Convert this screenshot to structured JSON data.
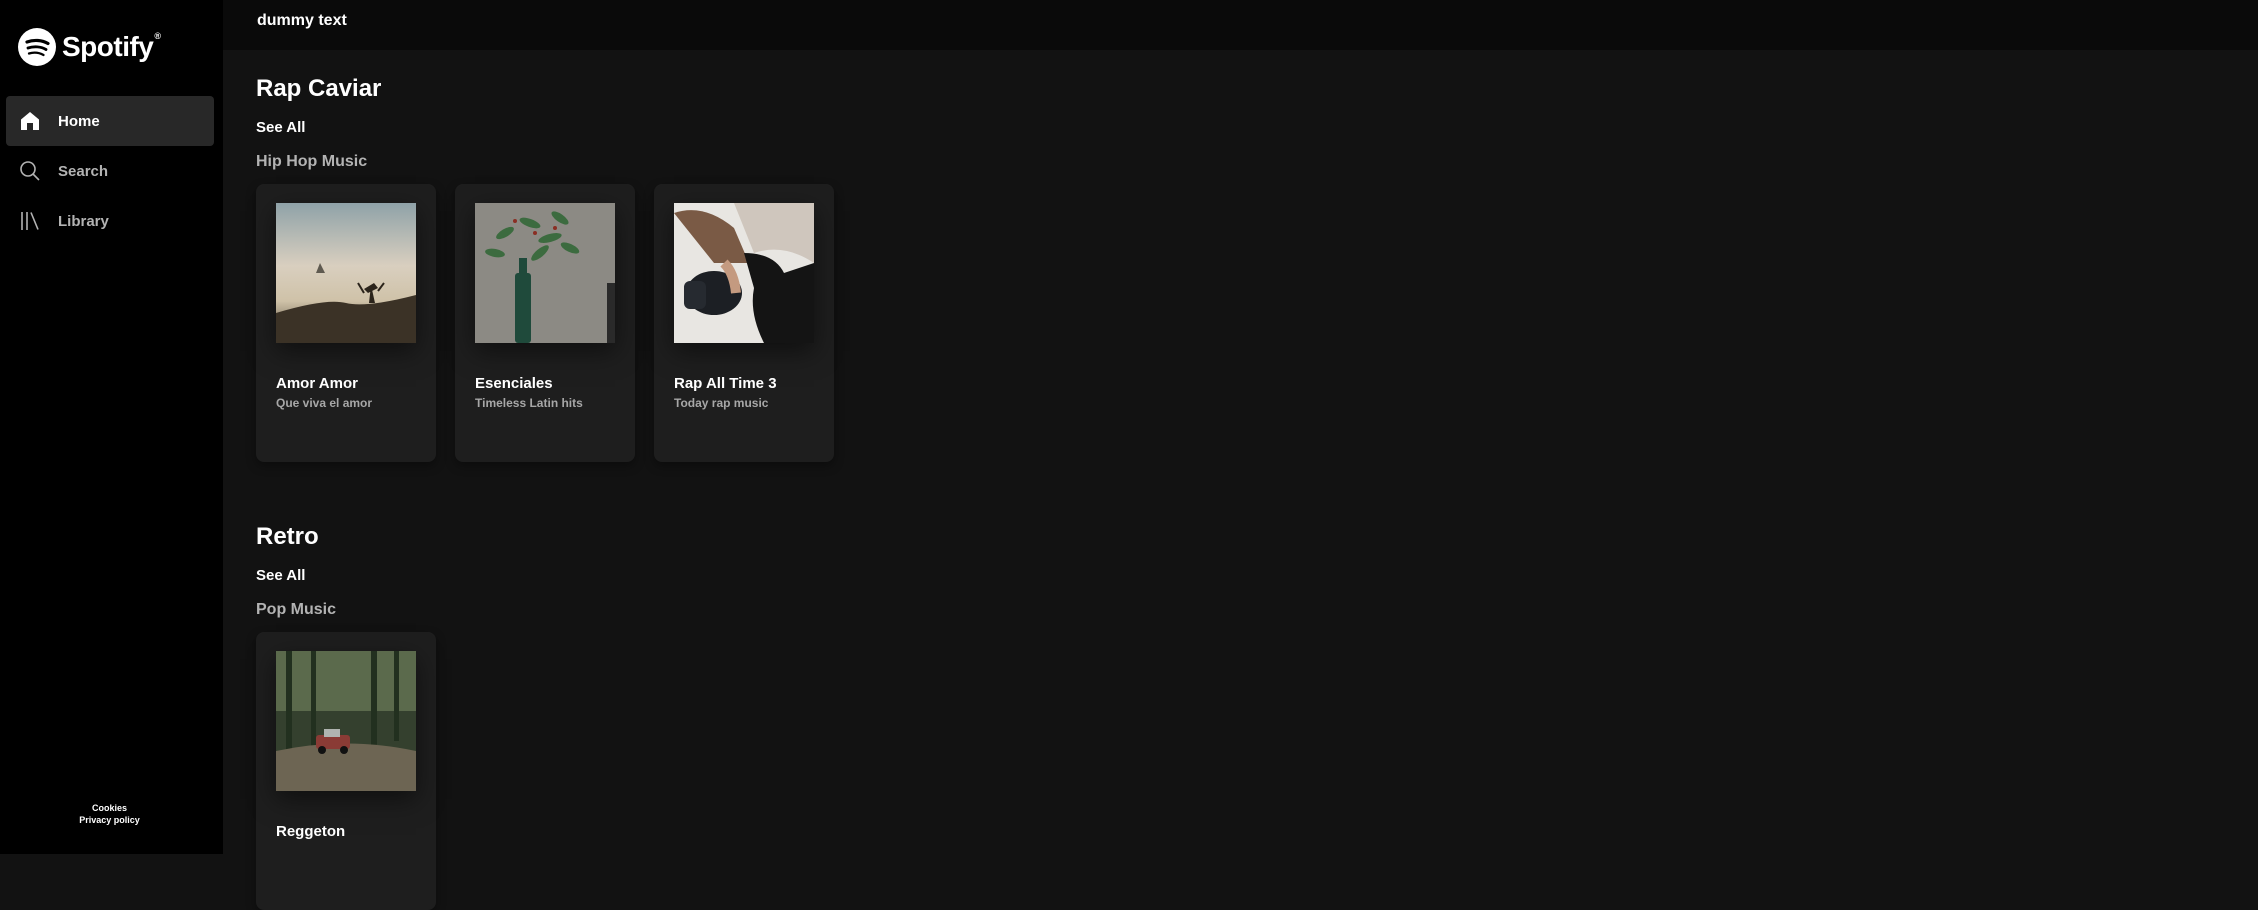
{
  "brand": {
    "name": "Spotify",
    "reg": "®"
  },
  "sidebar": {
    "items": [
      {
        "label": "Home",
        "icon": "home-icon",
        "active": true
      },
      {
        "label": "Search",
        "icon": "search-icon",
        "active": false
      },
      {
        "label": "Library",
        "icon": "library-icon",
        "active": false
      }
    ],
    "legal": {
      "cookies": "Cookies",
      "privacy": "Privacy policy"
    }
  },
  "topbar": {
    "text": "dummy text"
  },
  "sections": [
    {
      "title": "Rap Caviar",
      "see_all": "See All",
      "subtitle": "Hip Hop Music",
      "cards": [
        {
          "title": "Amor Amor",
          "subtitle": "Que viva el amor"
        },
        {
          "title": "Esenciales",
          "subtitle": "Timeless Latin hits"
        },
        {
          "title": "Rap All Time 3",
          "subtitle": "Today rap music"
        }
      ]
    },
    {
      "title": "Retro",
      "see_all": "See All",
      "subtitle": "Pop Music",
      "cards": [
        {
          "title": "Reggeton",
          "subtitle": ""
        }
      ]
    }
  ],
  "colors": {
    "background": "#121212",
    "sidebar": "#000000",
    "card": "#1e1e1e",
    "muted_text": "#b3b3b3"
  }
}
